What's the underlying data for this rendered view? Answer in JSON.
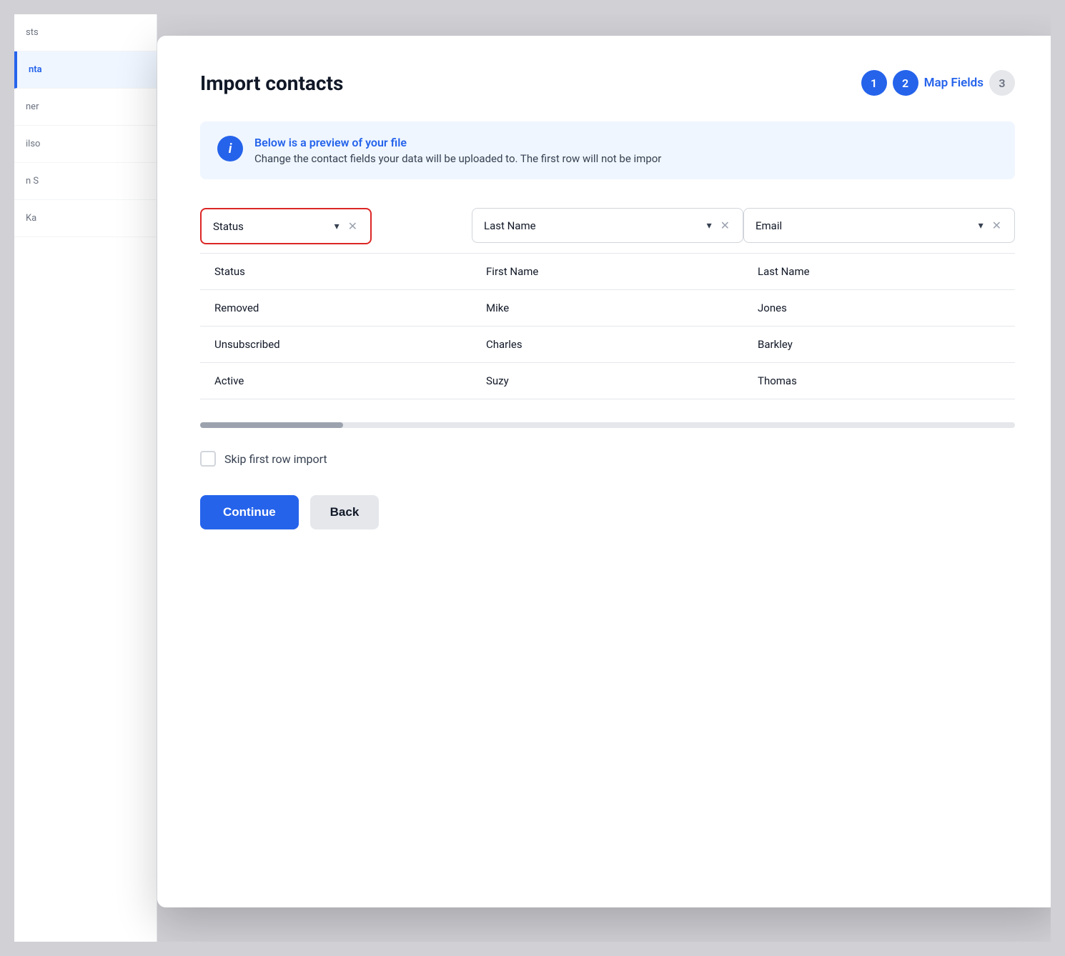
{
  "modal": {
    "title": "Import contacts",
    "steps": [
      {
        "number": "1",
        "state": "active"
      },
      {
        "number": "2",
        "state": "current",
        "label": "Map Fields"
      },
      {
        "number": "3",
        "state": "inactive"
      }
    ],
    "info_banner": {
      "title": "Below is a preview of your file",
      "subtitle": "Change the contact fields your data will be uploaded to. The first row will not be impor"
    },
    "columns": [
      {
        "id": "status",
        "field_label": "Status",
        "highlighted": true
      },
      {
        "id": "last_name",
        "field_label": "Last Name",
        "highlighted": false
      },
      {
        "id": "email",
        "field_label": "Email",
        "highlighted": false
      }
    ],
    "table_rows": [
      {
        "id": "header",
        "cells": [
          "Status",
          "First Name",
          "Last Name"
        ]
      },
      {
        "id": "row1",
        "cells": [
          "Removed",
          "Mike",
          "Jones"
        ]
      },
      {
        "id": "row2",
        "cells": [
          "Unsubscribed",
          "Charles",
          "Barkley"
        ]
      },
      {
        "id": "row3",
        "cells": [
          "Active",
          "Suzy",
          "Thomas"
        ]
      }
    ],
    "skip_import_label": "Skip first row import",
    "continue_button": "Continue",
    "back_button": "Back"
  },
  "sidebar": {
    "items": [
      {
        "label": "sts",
        "active": false
      },
      {
        "label": "nta",
        "active": true
      },
      {
        "label": "ner",
        "active": false
      },
      {
        "label": "ilso",
        "active": false
      },
      {
        "label": "n S",
        "active": false
      },
      {
        "label": "Ka",
        "active": false
      }
    ]
  }
}
